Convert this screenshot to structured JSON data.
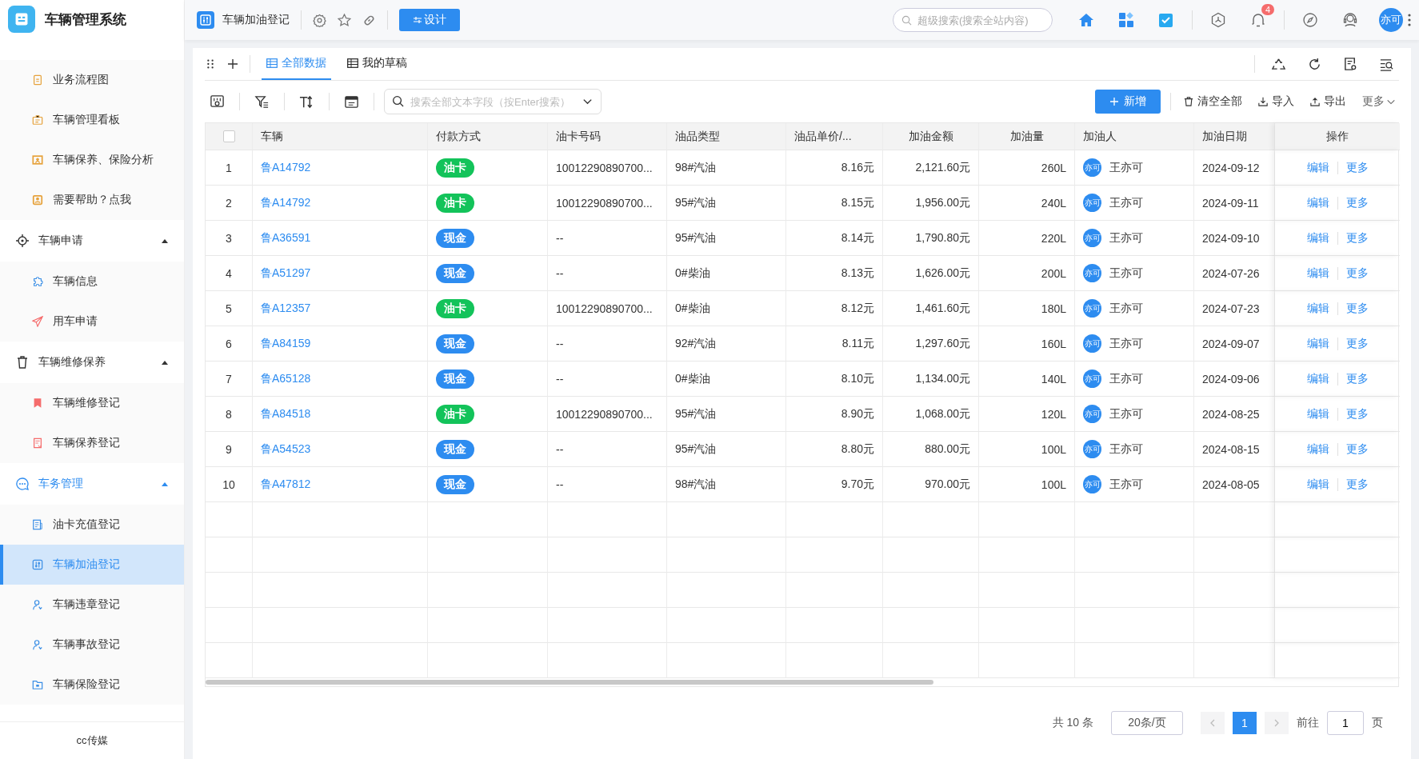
{
  "app": {
    "title": "车辆管理系统"
  },
  "sidebar": {
    "sections": [
      {
        "items": [
          {
            "label": "业务流程图",
            "selected": false,
            "color": "#e6a23c"
          },
          {
            "label": "车辆管理看板",
            "selected": false,
            "color": "#e6a23c"
          },
          {
            "label": "车辆保养、保险分析",
            "selected": false,
            "color": "#e6a23c"
          },
          {
            "label": "需要帮助？点我",
            "selected": false,
            "color": "#e6a23c"
          }
        ]
      },
      {
        "title": "车辆申请",
        "expanded": true,
        "active": false,
        "items": [
          {
            "label": "车辆信息",
            "selected": false,
            "color": "#3a8ee6"
          },
          {
            "label": "用车申请",
            "selected": false,
            "color": "#f56c6c"
          }
        ]
      },
      {
        "title": "车辆维修保养",
        "expanded": true,
        "active": false,
        "items": [
          {
            "label": "车辆维修登记",
            "selected": false,
            "color": "#f56c6c"
          },
          {
            "label": "车辆保养登记",
            "selected": false,
            "color": "#f56c6c"
          }
        ]
      },
      {
        "title": "车务管理",
        "expanded": true,
        "active": true,
        "items": [
          {
            "label": "油卡充值登记",
            "selected": false,
            "color": "#3a8ee6"
          },
          {
            "label": "车辆加油登记",
            "selected": true,
            "color": "#3a8ee6"
          },
          {
            "label": "车辆违章登记",
            "selected": false,
            "color": "#3a8ee6"
          },
          {
            "label": "车辆事故登记",
            "selected": false,
            "color": "#3a8ee6"
          },
          {
            "label": "车辆保险登记",
            "selected": false,
            "color": "#3a8ee6"
          }
        ]
      }
    ],
    "footer": "cc传媒"
  },
  "header": {
    "page_title": "车辆加油登记",
    "design_button": "设计",
    "search": {
      "placeholder": "超级搜索(搜索全站内容)"
    },
    "notification_count": "4",
    "avatar": "亦可"
  },
  "tabs": [
    {
      "label": "全部数据",
      "selected": true
    },
    {
      "label": "我的草稿",
      "selected": false
    }
  ],
  "toolbar": {
    "search": {
      "placeholder": "搜索全部文本字段（按Enter搜索）"
    },
    "buttons": [
      {
        "label": "新增",
        "kind": "primary"
      },
      {
        "label": "清空全部",
        "kind": "clear"
      },
      {
        "label": "导入",
        "kind": "import"
      },
      {
        "label": "导出",
        "kind": "export"
      },
      {
        "label": "更多",
        "kind": "more"
      }
    ]
  },
  "table": {
    "select_all": {
      "checked": false
    },
    "columns": [
      "车辆",
      "付款方式",
      "油卡号码",
      "油品类型",
      "油品单价/...",
      "加油金额",
      "加油量",
      "加油人",
      "加油日期",
      "操作"
    ],
    "rows": [
      {
        "index": "1",
        "vehicle": "鲁A14792",
        "payment": {
          "label": "油卡",
          "color": "#13c35a"
        },
        "card_no": "10012290890700...",
        "fuel": "98#汽油",
        "price": "8.16元",
        "amount": "2,121.60元",
        "volume": "260L",
        "person": {
          "avatar": "亦可",
          "name": "王亦可"
        },
        "date": "2024-09-12",
        "actions": [
          "编辑",
          "更多"
        ]
      },
      {
        "index": "2",
        "vehicle": "鲁A14792",
        "payment": {
          "label": "油卡",
          "color": "#13c35a"
        },
        "card_no": "10012290890700...",
        "fuel": "95#汽油",
        "price": "8.15元",
        "amount": "1,956.00元",
        "volume": "240L",
        "person": {
          "avatar": "亦可",
          "name": "王亦可"
        },
        "date": "2024-09-11",
        "actions": [
          "编辑",
          "更多"
        ]
      },
      {
        "index": "3",
        "vehicle": "鲁A36591",
        "payment": {
          "label": "现金",
          "color": "#2d8cf0"
        },
        "card_no": "--",
        "fuel": "95#汽油",
        "price": "8.14元",
        "amount": "1,790.80元",
        "volume": "220L",
        "person": {
          "avatar": "亦可",
          "name": "王亦可"
        },
        "date": "2024-09-10",
        "actions": [
          "编辑",
          "更多"
        ]
      },
      {
        "index": "4",
        "vehicle": "鲁A51297",
        "payment": {
          "label": "现金",
          "color": "#2d8cf0"
        },
        "card_no": "--",
        "fuel": "0#柴油",
        "price": "8.13元",
        "amount": "1,626.00元",
        "volume": "200L",
        "person": {
          "avatar": "亦可",
          "name": "王亦可"
        },
        "date": "2024-07-26",
        "actions": [
          "编辑",
          "更多"
        ]
      },
      {
        "index": "5",
        "vehicle": "鲁A12357",
        "payment": {
          "label": "油卡",
          "color": "#13c35a"
        },
        "card_no": "10012290890700...",
        "fuel": "0#柴油",
        "price": "8.12元",
        "amount": "1,461.60元",
        "volume": "180L",
        "person": {
          "avatar": "亦可",
          "name": "王亦可"
        },
        "date": "2024-07-23",
        "actions": [
          "编辑",
          "更多"
        ]
      },
      {
        "index": "6",
        "vehicle": "鲁A84159",
        "payment": {
          "label": "现金",
          "color": "#2d8cf0"
        },
        "card_no": "--",
        "fuel": "92#汽油",
        "price": "8.11元",
        "amount": "1,297.60元",
        "volume": "160L",
        "person": {
          "avatar": "亦可",
          "name": "王亦可"
        },
        "date": "2024-09-07",
        "actions": [
          "编辑",
          "更多"
        ]
      },
      {
        "index": "7",
        "vehicle": "鲁A65128",
        "payment": {
          "label": "现金",
          "color": "#2d8cf0"
        },
        "card_no": "--",
        "fuel": "0#柴油",
        "price": "8.10元",
        "amount": "1,134.00元",
        "volume": "140L",
        "person": {
          "avatar": "亦可",
          "name": "王亦可"
        },
        "date": "2024-09-06",
        "actions": [
          "编辑",
          "更多"
        ]
      },
      {
        "index": "8",
        "vehicle": "鲁A84518",
        "payment": {
          "label": "油卡",
          "color": "#13c35a"
        },
        "card_no": "10012290890700...",
        "fuel": "95#汽油",
        "price": "8.90元",
        "amount": "1,068.00元",
        "volume": "120L",
        "person": {
          "avatar": "亦可",
          "name": "王亦可"
        },
        "date": "2024-08-25",
        "actions": [
          "编辑",
          "更多"
        ]
      },
      {
        "index": "9",
        "vehicle": "鲁A54523",
        "payment": {
          "label": "现金",
          "color": "#2d8cf0"
        },
        "card_no": "--",
        "fuel": "95#汽油",
        "price": "8.80元",
        "amount": "880.00元",
        "volume": "100L",
        "person": {
          "avatar": "亦可",
          "name": "王亦可"
        },
        "date": "2024-08-15",
        "actions": [
          "编辑",
          "更多"
        ]
      },
      {
        "index": "10",
        "vehicle": "鲁A47812",
        "payment": {
          "label": "现金",
          "color": "#2d8cf0"
        },
        "card_no": "--",
        "fuel": "98#汽油",
        "price": "9.70元",
        "amount": "970.00元",
        "volume": "100L",
        "person": {
          "avatar": "亦可",
          "name": "王亦可"
        },
        "date": "2024-08-05",
        "actions": [
          "编辑",
          "更多"
        ]
      }
    ]
  },
  "pagination": {
    "total": "共 10 条",
    "page_size": "20条/页",
    "pages": [
      {
        "label": "1",
        "selected": true
      }
    ],
    "goto_label": "前往",
    "goto_value": "1",
    "goto_suffix": "页"
  }
}
